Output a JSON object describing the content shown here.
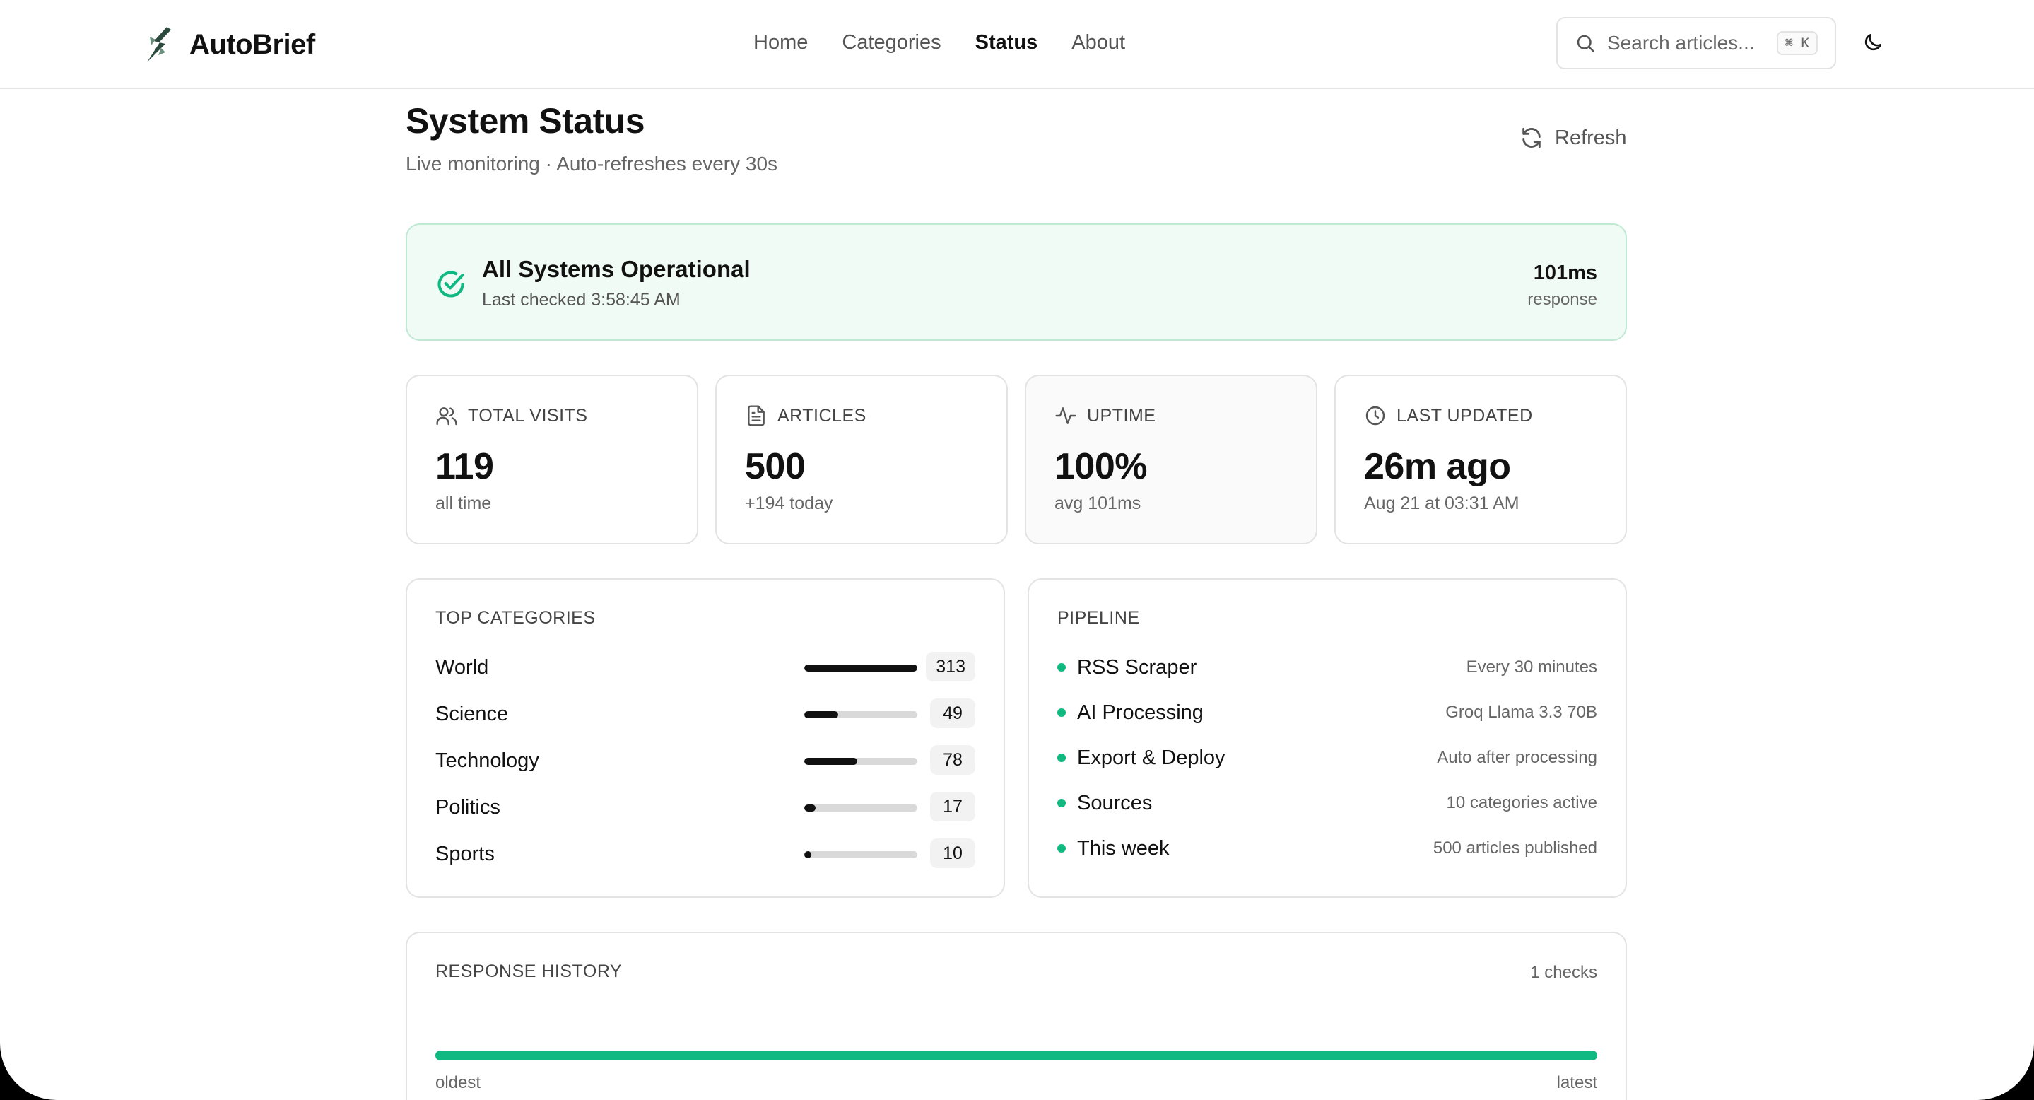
{
  "header": {
    "brand": "AutoBrief",
    "logo_icon": "lightning-bird-icon",
    "nav": [
      {
        "label": "Home",
        "active": false
      },
      {
        "label": "Categories",
        "active": false
      },
      {
        "label": "Status",
        "active": true
      },
      {
        "label": "About",
        "active": false
      }
    ],
    "search": {
      "placeholder": "Search articles...",
      "shortcut": "⌘ K"
    },
    "theme_icon": "moon-icon"
  },
  "page": {
    "title": "System Status",
    "subtitle": "Live monitoring · Auto-refreshes every 30s",
    "refresh_label": "Refresh"
  },
  "banner": {
    "title": "All Systems Operational",
    "last_checked": "Last checked 3:58:45 AM",
    "response_value": "101ms",
    "response_label": "response",
    "status_color": "#10b981"
  },
  "stats": [
    {
      "label": "TOTAL VISITS",
      "value": "119",
      "sub": "all time",
      "icon": "users-icon"
    },
    {
      "label": "ARTICLES",
      "value": "500",
      "sub": "+194 today",
      "icon": "document-icon"
    },
    {
      "label": "UPTIME",
      "value": "100%",
      "sub": "avg 101ms",
      "icon": "activity-icon"
    },
    {
      "label": "LAST UPDATED",
      "value": "26m ago",
      "sub": "Aug 21 at 03:31 AM",
      "icon": "clock-icon"
    }
  ],
  "top_categories": {
    "title": "TOP CATEGORIES",
    "items": [
      {
        "name": "World",
        "count": "313",
        "fraction": 1.0
      },
      {
        "name": "Science",
        "count": "49",
        "fraction": 0.3
      },
      {
        "name": "Technology",
        "count": "78",
        "fraction": 0.47
      },
      {
        "name": "Politics",
        "count": "17",
        "fraction": 0.1
      },
      {
        "name": "Sports",
        "count": "10",
        "fraction": 0.06
      }
    ]
  },
  "pipeline": {
    "title": "PIPELINE",
    "items": [
      {
        "name": "RSS Scraper",
        "detail": "Every 30 minutes"
      },
      {
        "name": "AI Processing",
        "detail": "Groq Llama 3.3 70B"
      },
      {
        "name": "Export & Deploy",
        "detail": "Auto after processing"
      },
      {
        "name": "Sources",
        "detail": "10 categories active"
      },
      {
        "name": "This week",
        "detail": "500 articles published"
      }
    ]
  },
  "history": {
    "title": "RESPONSE HISTORY",
    "count": "1 checks",
    "oldest": "oldest",
    "latest": "latest"
  }
}
